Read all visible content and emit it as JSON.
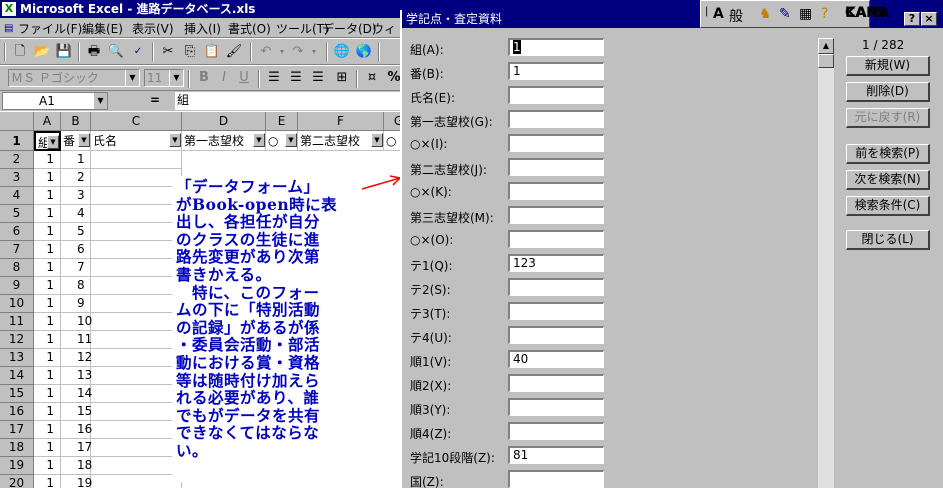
{
  "excel": {
    "title": "Microsoft Excel - 進路データベース.xls",
    "menu": [
      "ファイル(F)",
      "編集(E)",
      "表示(V)",
      "挿入(I)",
      "書式(O)",
      "ツール(T)",
      "データ(D)",
      "ウィント"
    ],
    "font_name": "ＭＳ Ｐゴシック",
    "font_size": "11",
    "name_box": "A1",
    "formula_eq": "=",
    "formula_value": "組",
    "columns": [
      "A",
      "B",
      "C",
      "D",
      "E",
      "F",
      "G"
    ],
    "header_row": {
      "row_num": "1",
      "cells": [
        "組",
        "番",
        "氏名",
        "第一志望校",
        "○",
        "第二志望校",
        "○"
      ]
    },
    "rows": [
      {
        "n": "2",
        "a": "1",
        "b": "1"
      },
      {
        "n": "3",
        "a": "1",
        "b": "2"
      },
      {
        "n": "4",
        "a": "1",
        "b": "3"
      },
      {
        "n": "5",
        "a": "1",
        "b": "4"
      },
      {
        "n": "6",
        "a": "1",
        "b": "5"
      },
      {
        "n": "7",
        "a": "1",
        "b": "6"
      },
      {
        "n": "8",
        "a": "1",
        "b": "7"
      },
      {
        "n": "9",
        "a": "1",
        "b": "8"
      },
      {
        "n": "10",
        "a": "1",
        "b": "9"
      },
      {
        "n": "11",
        "a": "1",
        "b": "10"
      },
      {
        "n": "12",
        "a": "1",
        "b": "11"
      },
      {
        "n": "13",
        "a": "1",
        "b": "12"
      },
      {
        "n": "14",
        "a": "1",
        "b": "13"
      },
      {
        "n": "15",
        "a": "1",
        "b": "14"
      },
      {
        "n": "16",
        "a": "1",
        "b": "15"
      },
      {
        "n": "17",
        "a": "1",
        "b": "16"
      },
      {
        "n": "18",
        "a": "1",
        "b": "17"
      },
      {
        "n": "19",
        "a": "1",
        "b": "18"
      },
      {
        "n": "20",
        "a": "1",
        "b": "19"
      }
    ]
  },
  "note": {
    "lines": [
      "「データフォーム」",
      "がBook-open時に表",
      "出し、各担任が自分",
      "のクラスの生徒に進",
      "路先変更があり次第",
      "書きかえる。",
      "　特に、このフォー",
      "ムの下に「特別活動",
      "の記録」があるが係",
      "・委員会活動・部活",
      "動における賞・資格",
      "等は随時付け加えら",
      "れる必要があり、誰",
      "でもがデータを共有",
      "できなくてはならな",
      "い。"
    ]
  },
  "dialog": {
    "title": "学記点・査定資料",
    "record_position": "1 / 282",
    "fields": [
      {
        "label": "組(A):",
        "value": "1",
        "selected": true
      },
      {
        "label": "番(B):",
        "value": "1"
      },
      {
        "label": "氏名(E):",
        "value": ""
      },
      {
        "label": "第一志望校(G):",
        "value": ""
      },
      {
        "label": "○×(I):",
        "value": ""
      },
      {
        "label": "第二志望校(J):",
        "value": ""
      },
      {
        "label": "○×(K):",
        "value": ""
      },
      {
        "label": "第三志望校(M):",
        "value": ""
      },
      {
        "label": "○×(O):",
        "value": ""
      },
      {
        "label": "テ1(Q):",
        "value": "123"
      },
      {
        "label": "テ2(S):",
        "value": ""
      },
      {
        "label": "テ3(T):",
        "value": ""
      },
      {
        "label": "テ4(U):",
        "value": ""
      },
      {
        "label": "順1(V):",
        "value": "40"
      },
      {
        "label": "順2(X):",
        "value": ""
      },
      {
        "label": "順3(Y):",
        "value": ""
      },
      {
        "label": "順4(Z):",
        "value": ""
      },
      {
        "label": "学記10段階(Z):",
        "value": "81"
      },
      {
        "label": "国(Z):",
        "value": ""
      }
    ],
    "buttons": [
      {
        "label": "新規(W)",
        "enabled": true
      },
      {
        "label": "削除(D)",
        "enabled": true
      },
      {
        "label": "元に戻す(R)",
        "enabled": false
      },
      {
        "label": "前を検索(P)",
        "enabled": true
      },
      {
        "label": "次を検索(N)",
        "enabled": true
      },
      {
        "label": "検索条件(C)",
        "enabled": true
      },
      {
        "label": "閉じる(L)",
        "enabled": true
      }
    ]
  },
  "ime": {
    "mode": "般",
    "alpha": "A",
    "caps": "CAPS",
    "kana": "KANA"
  },
  "colors": {
    "titlebar": "#000080",
    "face": "#c0c0c0",
    "note_text": "#0000c0",
    "arrow": "#ff0000"
  },
  "icons": [
    "excel-app-icon",
    "new-icon",
    "open-icon",
    "save-icon",
    "print-icon",
    "preview-icon",
    "spell-icon",
    "cut-icon",
    "copy-icon",
    "paste-icon",
    "format-painter-icon",
    "undo-icon",
    "redo-icon",
    "web-icon",
    "bold-icon",
    "italic-icon",
    "underline-icon",
    "align-left-icon",
    "center-icon",
    "align-right-icon",
    "merge-icon",
    "currency-icon",
    "percent-icon"
  ]
}
